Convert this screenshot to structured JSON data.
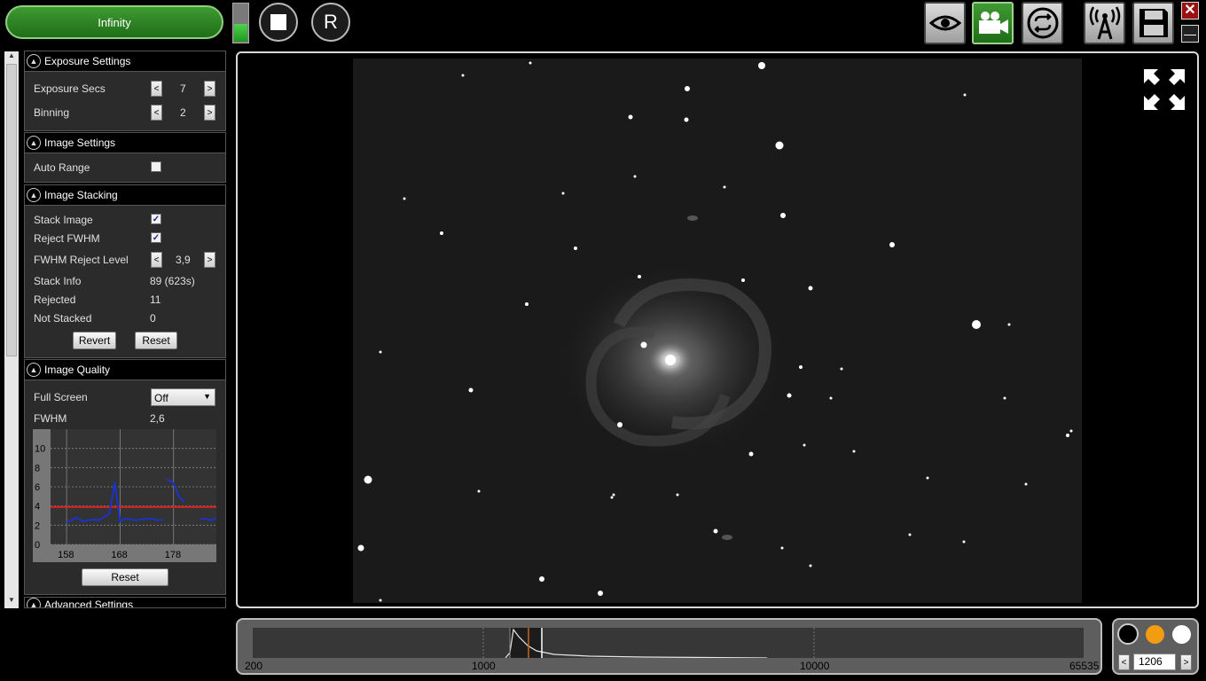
{
  "toolbar": {
    "infinity_label": "Infinity",
    "stop_icon": "stop-icon",
    "reset_label": "R",
    "buttons": [
      "eye-icon",
      "video-camera-icon",
      "loop-icon",
      "broadcast-tower-icon",
      "save-icon"
    ],
    "close_label": "✕",
    "minimize_label": "—",
    "level_fraction": 0.45
  },
  "exposure": {
    "header": "Exposure Settings",
    "exposure_label": "Exposure Secs",
    "exposure_value": "7",
    "binning_label": "Binning",
    "binning_value": "2",
    "dec": "<",
    "inc": ">"
  },
  "image_settings": {
    "header": "Image Settings",
    "auto_range_label": "Auto Range",
    "auto_range_checked": false
  },
  "stacking": {
    "header": "Image Stacking",
    "stack_image_label": "Stack Image",
    "reject_fwhm_label": "Reject FWHM",
    "fwhm_level_label": "FWHM Reject Level",
    "fwhm_level_value": "3,9",
    "stack_info_label": "Stack Info",
    "stack_info_value": "89 (623s)",
    "rejected_label": "Rejected",
    "rejected_value": "11",
    "not_stacked_label": "Not Stacked",
    "not_stacked_value": "0",
    "revert_label": "Revert",
    "reset_label": "Reset",
    "check": "✓"
  },
  "quality": {
    "header": "Image Quality",
    "full_screen_label": "Full Screen",
    "full_screen_value": "Off",
    "fwhm_label": "FWHM",
    "fwhm_value": "2,6",
    "reset_label": "Reset"
  },
  "advanced": {
    "header": "Advanced Settings"
  },
  "chart_data": {
    "type": "line",
    "title": "",
    "xlabel": "",
    "ylabel": "",
    "xlim": [
      155,
      186
    ],
    "ylim": [
      0,
      12
    ],
    "x_ticks": [
      "158",
      "168",
      "178"
    ],
    "y_ticks": [
      "0",
      "2",
      "4",
      "6",
      "8",
      "10"
    ],
    "threshold": 3.9,
    "series": [
      {
        "color": "#1a33c8",
        "points": [
          [
            158,
            2.3
          ],
          [
            160,
            2.8
          ],
          [
            161,
            2.4
          ],
          [
            162,
            2.5
          ],
          [
            163,
            2.6
          ],
          [
            164,
            2.5
          ],
          [
            166,
            3.2
          ],
          [
            167,
            6.5
          ],
          [
            168,
            2.4
          ],
          [
            169,
            2.7
          ],
          [
            170,
            2.6
          ],
          [
            171,
            2.5
          ],
          [
            172,
            2.6
          ],
          [
            174,
            2.7
          ],
          [
            175,
            2.5
          ],
          [
            176,
            2.6
          ],
          [
            176.5,
            null
          ],
          [
            183,
            2.6
          ],
          [
            184,
            2.7
          ],
          [
            185,
            2.5
          ],
          [
            186,
            2.8
          ]
        ]
      },
      {
        "color": "#1a33c8",
        "points": [
          [
            176.7,
            6.8
          ],
          [
            178,
            6.4
          ],
          [
            179,
            5.0
          ],
          [
            180,
            4.4
          ]
        ]
      }
    ]
  },
  "histogram": {
    "labels": [
      "200",
      "1000",
      "10000",
      "65535"
    ],
    "value": "1206",
    "dec": "<",
    "inc": ">"
  },
  "dots": [
    "black-dot-icon",
    "orange-dot-icon",
    "white-dot-icon"
  ],
  "colors": {
    "accent_green": "#2d8a25",
    "threshold": "#e02020",
    "orange": "#f39c12"
  }
}
